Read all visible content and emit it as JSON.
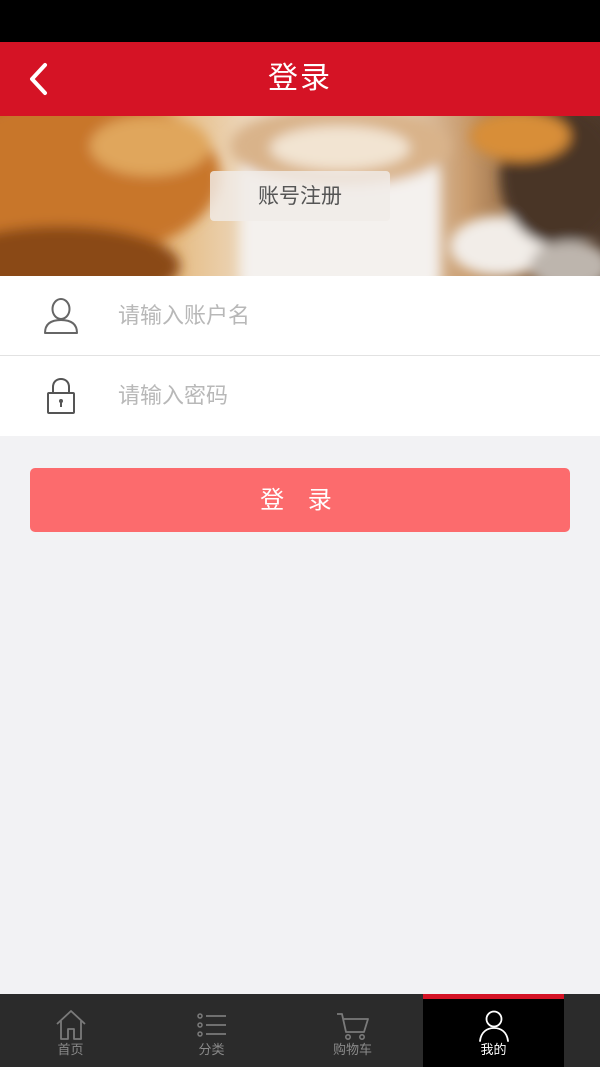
{
  "header": {
    "title": "登录",
    "back_icon": "chevron-left-icon",
    "background_color": "#d51325"
  },
  "banner": {
    "register_label": "账号注册"
  },
  "form": {
    "username": {
      "icon": "user-icon",
      "placeholder": "请输入账户名",
      "value": ""
    },
    "password": {
      "icon": "lock-icon",
      "placeholder": "请输入密码",
      "value": ""
    }
  },
  "login_button": {
    "label": "登 录",
    "color": "#fc6b6d"
  },
  "tab_bar": {
    "tabs": [
      {
        "label": "首页",
        "icon": "home-icon",
        "active": false
      },
      {
        "label": "分类",
        "icon": "list-icon",
        "active": false
      },
      {
        "label": "购物车",
        "icon": "cart-icon",
        "active": false
      },
      {
        "label": "我的",
        "icon": "person-icon",
        "active": true
      }
    ],
    "active_color": "#d51325"
  }
}
